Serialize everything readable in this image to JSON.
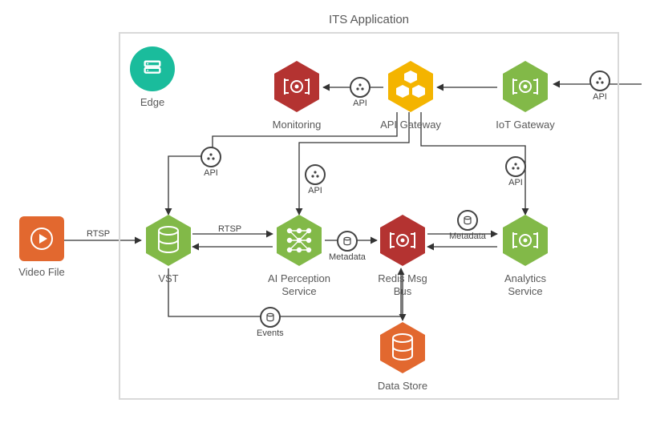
{
  "title": "ITS Application",
  "nodes": {
    "edge": {
      "label": "Edge"
    },
    "monitoring": {
      "label": "Monitoring"
    },
    "apigw": {
      "label": "API Gateway"
    },
    "iotgw": {
      "label": "IoT Gateway"
    },
    "video": {
      "label": "Video File"
    },
    "vst": {
      "label": "VST"
    },
    "ai": {
      "label": "AI Perception Service"
    },
    "redis": {
      "label": "Redis Msg Bus"
    },
    "analytics": {
      "label": "Analytics Service"
    },
    "datastore": {
      "label": "Data Store"
    }
  },
  "badges": {
    "api": "API",
    "metadata": "Metadata",
    "events": "Events"
  },
  "edge_labels": {
    "rtsp": "RTSP"
  },
  "colors": {
    "green": "#82b948",
    "red": "#b43331",
    "amber": "#f4b400",
    "orange": "#e2682f",
    "teal": "#1abc9c",
    "outline": "#d9d9d9"
  }
}
